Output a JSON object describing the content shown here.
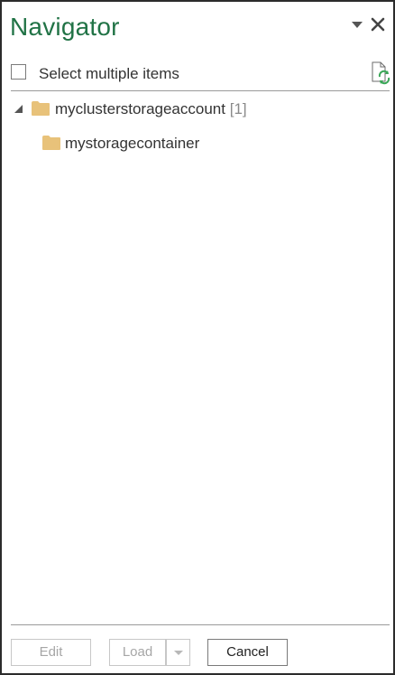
{
  "header": {
    "title": "Navigator",
    "menu_icon": "chevron-down-icon",
    "close_icon": "close-icon"
  },
  "toolbar": {
    "select_multiple_label": "Select multiple items",
    "select_multiple_checked": false,
    "refresh_icon": "refresh-icon"
  },
  "tree": {
    "root": {
      "label": "myclusterstorageaccount",
      "count": "[1]",
      "expanded": true,
      "icon": "folder-icon"
    },
    "children": [
      {
        "label": "mystoragecontainer",
        "icon": "folder-icon"
      }
    ]
  },
  "footer": {
    "edit_label": "Edit",
    "load_label": "Load",
    "cancel_label": "Cancel"
  },
  "colors": {
    "title": "#217346",
    "folder": "#e8c27a",
    "refresh": "#3aa757"
  }
}
